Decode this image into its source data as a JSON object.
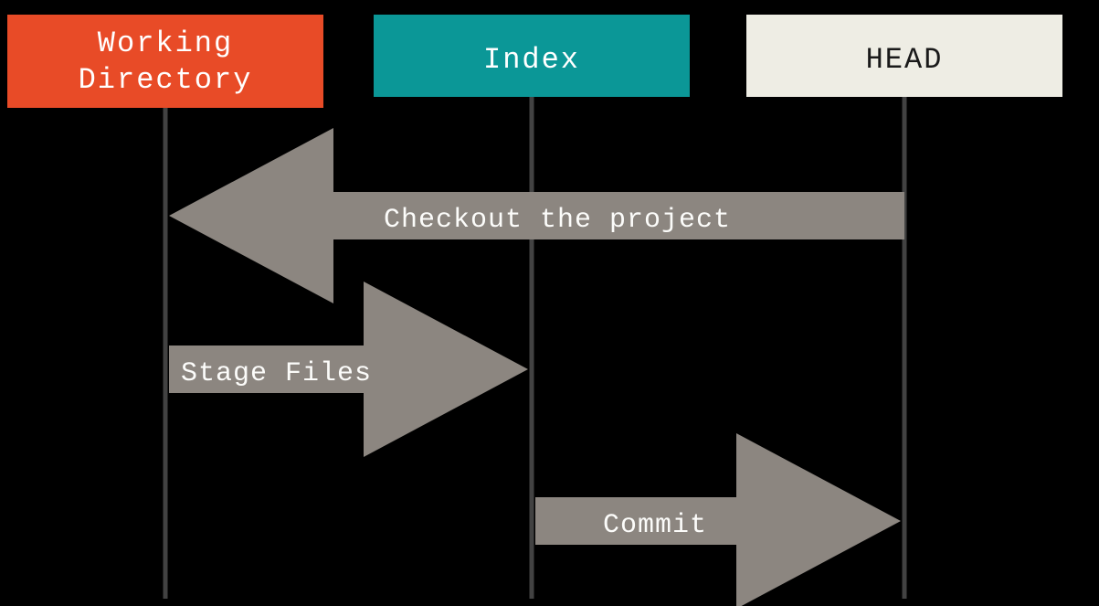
{
  "colors": {
    "working": "#e84b27",
    "index": "#0b9797",
    "head": "#eeede4",
    "arrow": "#8c8680",
    "lifeline": "#424242"
  },
  "columns": {
    "working": {
      "line1": "Working",
      "line2": "Directory"
    },
    "index": {
      "label": "Index"
    },
    "head": {
      "label": "HEAD"
    }
  },
  "arrows": {
    "checkout": "Checkout the project",
    "stage": "Stage Files",
    "commit": "Commit"
  }
}
